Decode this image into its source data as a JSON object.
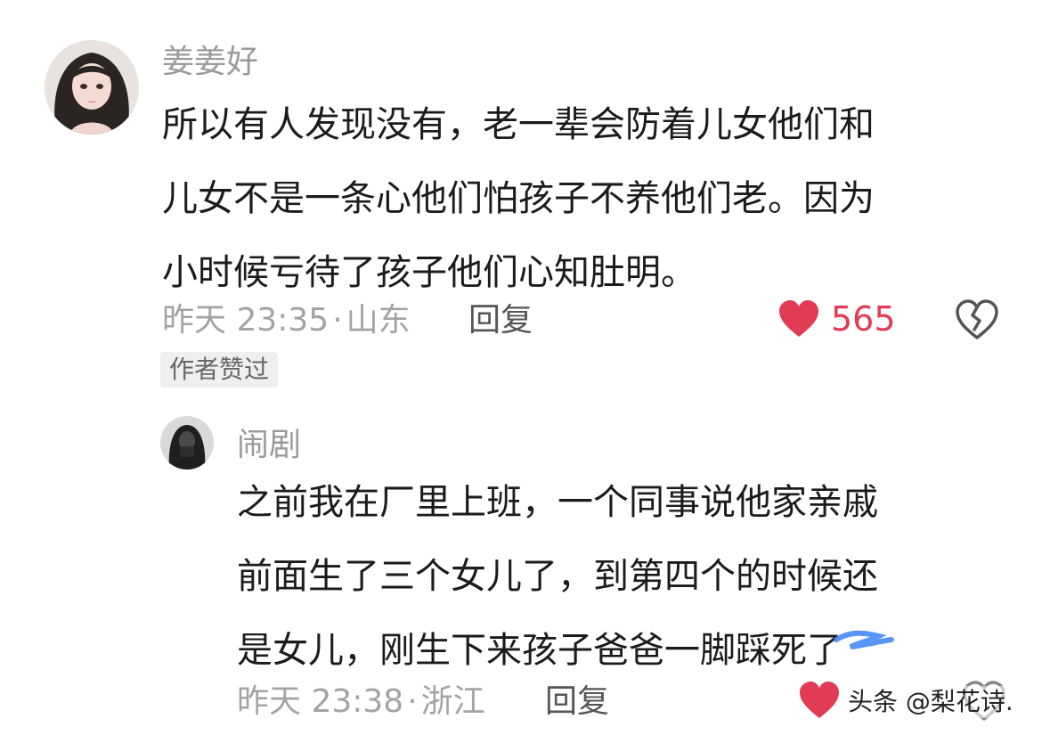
{
  "comments": [
    {
      "username": "姜姜好",
      "lines": [
        "所以有人发现没有，老一辈会防着儿女他们和",
        "儿女不是一条心他们怕孩子不养他们老。因为",
        "小时候亏待了孩子他们心知肚明。"
      ],
      "time": "昨天 23:35",
      "location": "山东",
      "reply_label": "回复",
      "likes": "565",
      "badge": "作者赞过"
    },
    {
      "username": "闹剧",
      "lines": [
        "之前我在厂里上班，一个同事说他家亲戚",
        "前面生了三个女儿了，到第四个的时候还",
        "是女儿，刚生下来孩子爸爸一脚踩死了"
      ],
      "time": "昨天 23:38",
      "location": "浙江",
      "reply_label": "回复"
    }
  ],
  "watermark": "头条 @梨花诗.",
  "colors": {
    "like": "#e23b55",
    "muted": "#a3a3a3",
    "text": "#1b1b1b",
    "scribble": "#3b82f6"
  },
  "icons": {
    "like": "heart-icon",
    "dislike": "broken-heart-icon"
  }
}
